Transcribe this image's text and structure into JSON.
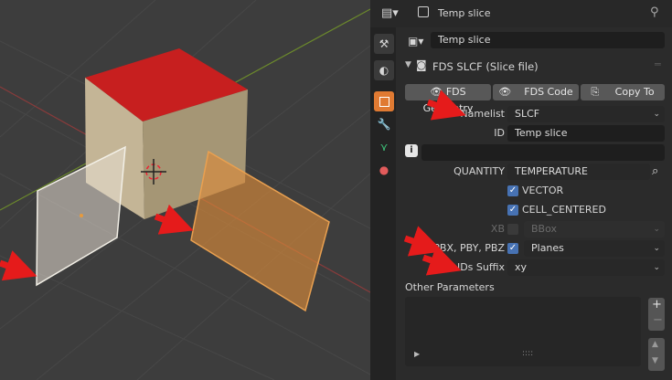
{
  "header": {
    "object_name": "Temp slice"
  },
  "datablock": {
    "name": "Temp slice"
  },
  "panel": {
    "title": "FDS SLCF (Slice file)",
    "buttons": {
      "geometry": "FDS Geometry",
      "code": "FDS Code",
      "copy": "Copy To"
    },
    "namelist": {
      "label": "Namelist",
      "value": "SLCF"
    },
    "id": {
      "label": "ID",
      "value": "Temp slice"
    },
    "info_value": "",
    "quantity": {
      "label": "QUANTITY",
      "value": "TEMPERATURE"
    },
    "vector": {
      "label": "VECTOR",
      "checked": true
    },
    "cell_centered": {
      "label": "CELL_CENTERED",
      "checked": true
    },
    "xb": {
      "label": "XB",
      "value": "BBox",
      "enabled": false
    },
    "pbx": {
      "label": "PBX, PBY, PBZ",
      "value": "Planes",
      "checked": true
    },
    "ids_suffix": {
      "label": "IDs Suffix",
      "value": "xy"
    },
    "other_params": {
      "label": "Other Parameters",
      "scroll_indicator": "::::"
    }
  },
  "icons": [
    "view-layer-icon",
    "object-icon",
    "pin-icon",
    "tool-icon",
    "render-icon",
    "modifier-icon",
    "particles-icon",
    "physics-icon",
    "camera-icon",
    "eye-icon",
    "copy-icon",
    "info-icon",
    "search-icon",
    "plus-icon",
    "minus-icon",
    "arrow-up-icon",
    "arrow-down-icon"
  ],
  "colors": {
    "cube_top": "#c71f1f",
    "cube_side": "#c4b596",
    "slice_selected": "#d88a3b",
    "accent": "#4772b3",
    "arrow": "#e51b1b"
  }
}
